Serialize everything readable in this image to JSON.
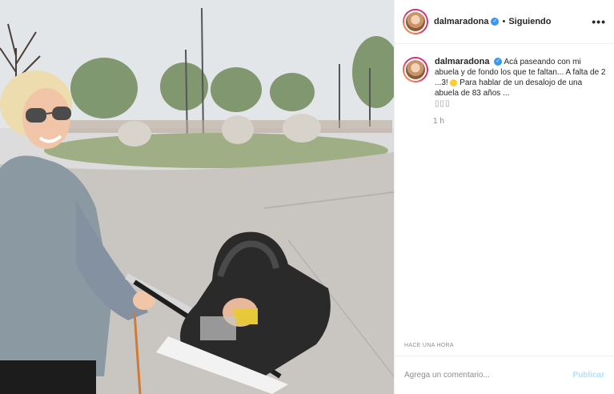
{
  "post": {
    "username": "dalmaradona",
    "verified_icon": "verified-badge-icon",
    "separator": "•",
    "follow_status": "Siguiendo",
    "more_icon": "more-options-icon",
    "more_glyph": "•••"
  },
  "caption": {
    "username": "dalmaradona",
    "text_part1": "Acá paseando con mi abuela y de fondo los que te faltan... A falta de 2 ...3!",
    "text_part2": "Para hablar de un desalojo de una abuela de 83 años ...",
    "trailing_glyphs": "▯▯▯",
    "time_ago": "1 h"
  },
  "meta": {
    "date_label": "HACE UNA HORA"
  },
  "footer": {
    "comment_placeholder": "Agrega un comentario...",
    "publish_label": "Publicar"
  },
  "colors": {
    "link_blue": "#3897f0",
    "publish_disabled": "#b2dffc",
    "text_primary": "#262626",
    "text_secondary": "#8e8e8e"
  }
}
